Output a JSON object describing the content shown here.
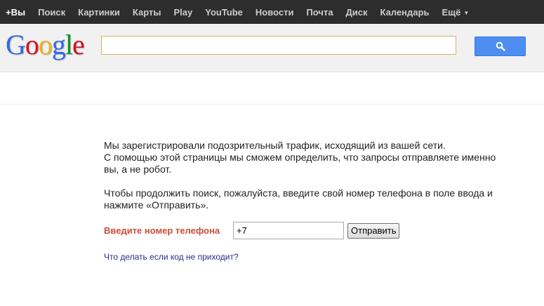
{
  "topbar": {
    "items": [
      "+Вы",
      "Поиск",
      "Картинки",
      "Карты",
      "Play",
      "YouTube",
      "Новости",
      "Почта",
      "Диск",
      "Календарь",
      "Ещё"
    ],
    "more_arrow_icon": "triangle-down"
  },
  "header": {
    "logo": [
      "G",
      "o",
      "o",
      "g",
      "l",
      "e"
    ],
    "logo_colors": [
      "#3369e8",
      "#d50f25",
      "#eeb211",
      "#3369e8",
      "#009925",
      "#d50f25"
    ],
    "search_value": "",
    "search_icon": "magnifier-icon",
    "search_button_color": "#4d8ef0"
  },
  "content": {
    "para1_line1": "Мы зарегистрировали подозрительный трафик, исходящий из вашей сети.",
    "para1_line2": "С помощью этой страницы мы сможем определить, что запросы отправляете именно вы, а не робот.",
    "para2": "Чтобы продолжить поиск, пожалуйста, введите свой номер телефона в поле ввода и нажмите «Отправить».",
    "phone_label": "Введите номер телефона",
    "phone_value": "+7",
    "submit_label": "Отправить",
    "help_link": "Что делать если код не приходит?",
    "label_color": "#c94e3a",
    "link_color": "#2a2a8c"
  }
}
